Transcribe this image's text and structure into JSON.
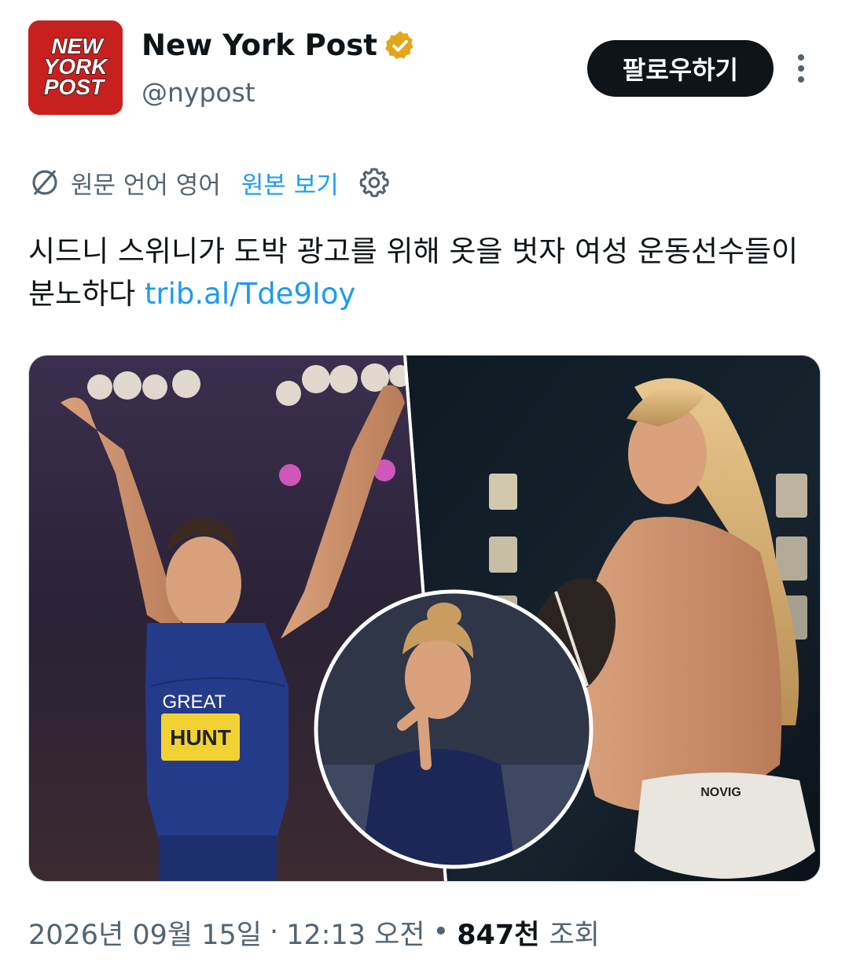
{
  "author": {
    "avatar_text_lines": [
      "NEW",
      "YORK",
      "POST"
    ],
    "name": "New York Post",
    "handle": "@nypost",
    "verified_color": "#e2a51c"
  },
  "actions": {
    "follow_label": "팔로우하기",
    "more_icon": "more-vertical-icon"
  },
  "translation": {
    "original_language": "원문 언어 영어",
    "show_original_label": "원본 보기",
    "translate_icon": "translate-icon",
    "settings_icon": "gear-icon"
  },
  "tweet": {
    "text": "시드니 스위니가 도박 광고를 위해 옷을 벗자 여성 운동선수들이 분노하다 ",
    "link_text": "trib.al/Tde9Ioy",
    "link_color": "#1d9bf0"
  },
  "media": {
    "bib_name": "HUNT",
    "jersey_text": "GREAT",
    "sponsor_text": "NOVIG"
  },
  "meta": {
    "date": "2026년 09월 15일",
    "separator1": "·",
    "time": "12:13 오전",
    "separator2": "•",
    "views": "847천",
    "views_label": "조회"
  },
  "colors": {
    "brand_red": "#c8201e",
    "text_primary": "#0f1419",
    "text_secondary": "#536471"
  }
}
